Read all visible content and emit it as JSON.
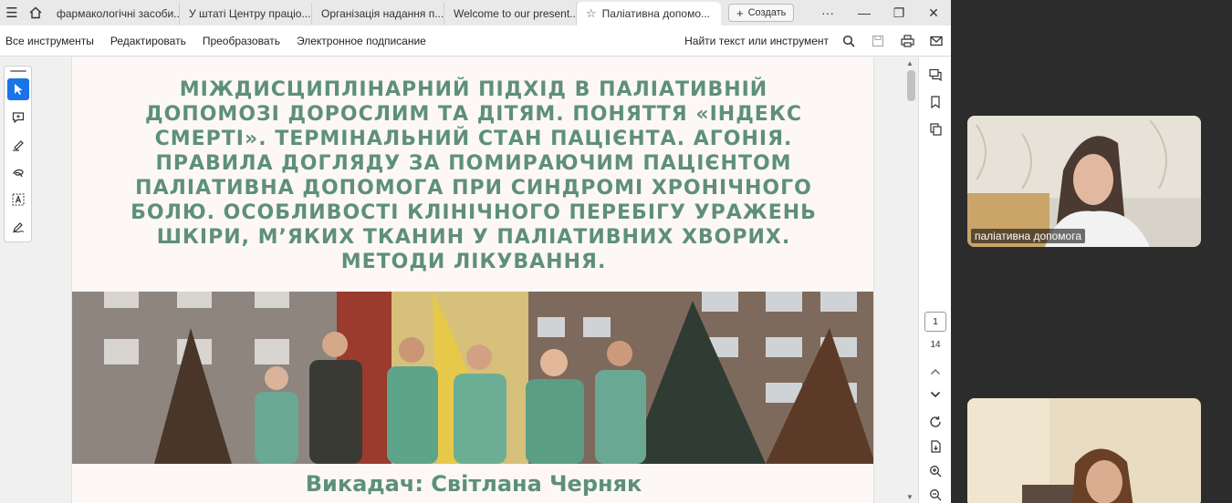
{
  "tabs": [
    {
      "label": "фармакологічні засоби..."
    },
    {
      "label": "У штаті Центру праціо..."
    },
    {
      "label": "Організація надання п..."
    },
    {
      "label": "Welcome to our present..."
    },
    {
      "label": "Паліативна допомо...",
      "active": true
    }
  ],
  "new_tab_label": "Создать",
  "toolbar": {
    "menu": [
      "Все инструменты",
      "Редактировать",
      "Преобразовать",
      "Электронное подписание"
    ],
    "find": "Найти текст или инструмент"
  },
  "document": {
    "title_lines": [
      "МІЖДИСЦИПЛІНАРНИЙ ПІДХІД В ПАЛІАТИВНІЙ",
      "ДОПОМОЗІ ДОРОСЛИМ ТА ДІТЯМ. ПОНЯТТЯ «ІНДЕКС",
      "СМЕРТІ». ТЕРМІНАЛЬНИЙ СТАН ПАЦІЄНТА. АГОНІЯ.",
      "ПРАВИЛА ДОГЛЯДУ ЗА ПОМИРАЮЧИМ ПАЦІЄНТОМ",
      "ПАЛІАТИВНА ДОПОМОГА ПРИ СИНДРОМІ ХРОНІЧНОГО",
      "БОЛЮ. ОСОБЛИВОСТІ КЛІНІЧНОГО ПЕРЕБІГУ УРАЖЕНЬ",
      "ШКІРИ, М’ЯКИХ ТКАНИН У ПАЛІАТИВНИХ ХВОРИХ.",
      "МЕТОДИ ЛІКУВАННЯ."
    ],
    "lecturer": "Викадач: Світлана Черняк"
  },
  "page_nav": {
    "current": "1",
    "total": "14"
  },
  "video": {
    "participant1": "паліативна допомога"
  },
  "colors": {
    "title": "#5e8f7d",
    "page_bg": "#fdf8f5",
    "selected_tool": "#1a73e8"
  }
}
